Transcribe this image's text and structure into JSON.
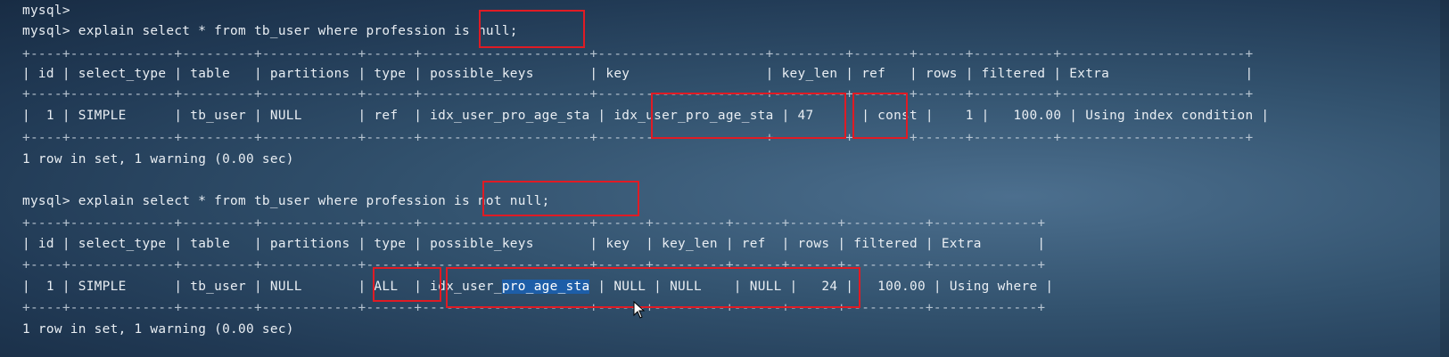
{
  "terminal": {
    "lines": [
      "mysql>",
      "mysql> explain select * from tb_user where profession is null;",
      "+----+-------------+---------+------------+------+---------------------+---------------------+---------+-------+------+----------+-----------------------+",
      "| id | select_type | table   | partitions | type | possible_keys       | key                 | key_len | ref   | rows | filtered | Extra                 |",
      "+----+-------------+---------+------------+------+---------------------+---------------------+---------+-------+------+----------+-----------------------+",
      "|  1 | SIMPLE      | tb_user | NULL       | ref  | idx_user_pro_age_sta | idx_user_pro_age_sta | 47      | const |    1 |   100.00 | Using index condition |",
      "+----+-------------+---------+------------+------+---------------------+---------------------+---------+-------+------+----------+-----------------------+",
      "1 row in set, 1 warning (0.00 sec)",
      "",
      "mysql> explain select * from tb_user where profession is not null;",
      "+----+-------------+---------+------------+------+---------------------+------+---------+------+------+----------+-------------+",
      "| id | select_type | table   | partitions | type | possible_keys       | key  | key_len | ref  | rows | filtered | Extra       |",
      "+----+-------------+---------+------------+------+---------------------+------+---------+------+------+----------+-------------+",
      "|  1 | SIMPLE      | tb_user | NULL       | ALL  | idx_user_",
      "+----+-------------+---------+------------+------+---------------------+------+---------+------+------+----------+-------------+",
      "1 row in set, 1 warning (0.00 sec)"
    ],
    "row2_selected": "pro_age_sta",
    "row2_tail": " | NULL | NULL    | NULL |   24 |   100.00 | Using where |"
  },
  "colors": {
    "highlight_box": "#e01b24",
    "selection": "#1d5ea8",
    "text": "#e9eef3"
  }
}
